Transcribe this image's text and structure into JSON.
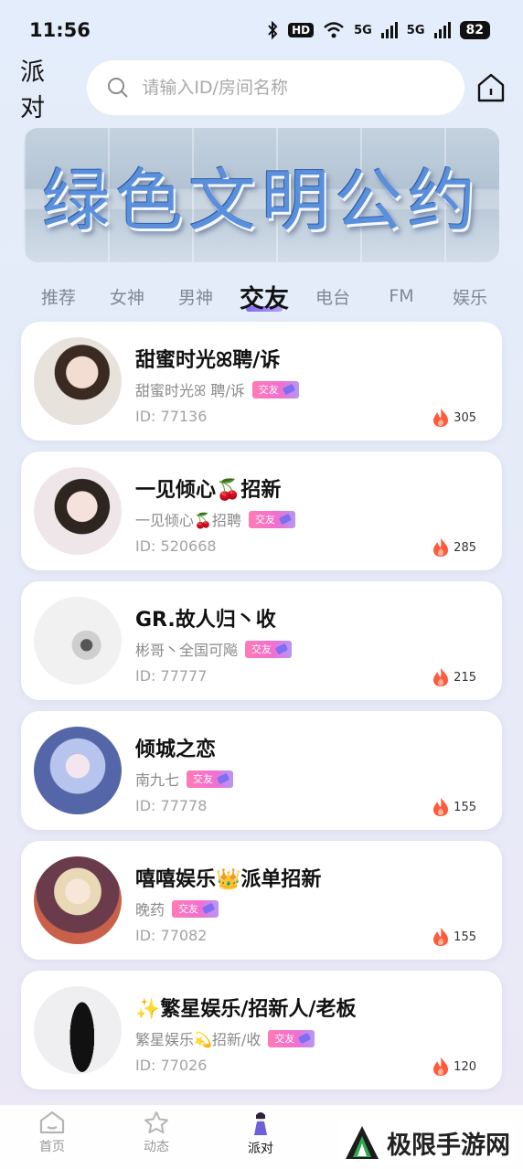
{
  "status_bar": {
    "time": "11:56",
    "hd": "HD",
    "net1": "5G",
    "net2": "5G",
    "battery": "82"
  },
  "header": {
    "title": "派对",
    "search_placeholder": "请输入ID/房间名称"
  },
  "banner": {
    "text": "绿色文明公约"
  },
  "tabs": [
    {
      "label": "推荐"
    },
    {
      "label": "女神"
    },
    {
      "label": "男神"
    },
    {
      "label": "交友",
      "active": true
    },
    {
      "label": "电台"
    },
    {
      "label": "FM"
    },
    {
      "label": "娱乐"
    }
  ],
  "tag_label": "交友",
  "rooms": [
    {
      "name": "甜蜜时光ꕤ聘/诉",
      "host": "甜蜜时光ꕤ 聘/诉",
      "id": "ID: 77136",
      "heat": "305"
    },
    {
      "name": "一见倾心🍒招新",
      "host": "一见倾心🍒招聘",
      "id": "ID: 520668",
      "heat": "285"
    },
    {
      "name": "GR.故人归丶收",
      "host": "彬哥丶全国可飚",
      "id": "ID: 77777",
      "heat": "215"
    },
    {
      "name": "倾城之恋",
      "host": "南九七",
      "id": "ID: 77778",
      "heat": "155"
    },
    {
      "name": "嘻嘻娱乐👑派单招新",
      "host": "晚药",
      "id": "ID: 77082",
      "heat": "155"
    },
    {
      "name": "✨繁星娱乐/招新人/老板",
      "host": "繁星娱乐💫招新/收",
      "id": "ID: 77026",
      "heat": "120"
    }
  ],
  "bottom_nav": [
    {
      "label": "首页",
      "icon": "home-icon"
    },
    {
      "label": "动态",
      "icon": "star-icon"
    },
    {
      "label": "派对",
      "icon": "party-icon",
      "active": true
    }
  ],
  "watermark": "极限手游网",
  "colors": {
    "accent": "#7f6bf2",
    "tag_pink": "#ff7bb5",
    "flame": "#ff5a3c"
  }
}
